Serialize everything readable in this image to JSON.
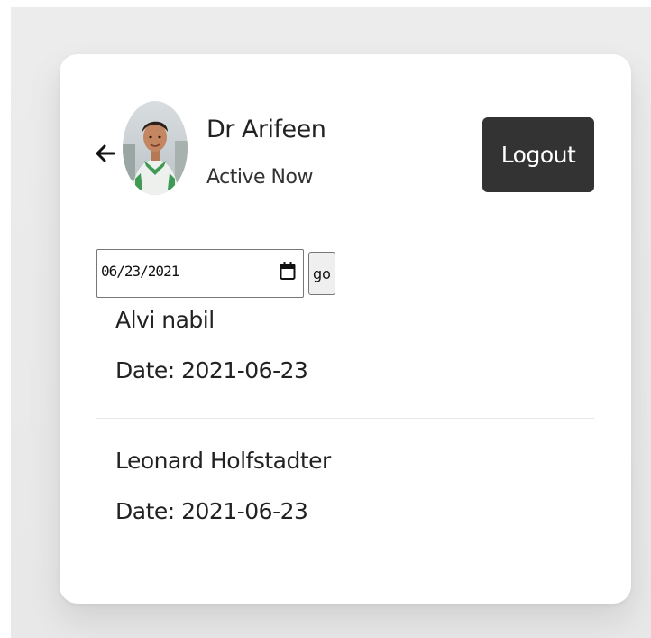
{
  "header": {
    "back_icon": "arrow-left-icon",
    "avatar_icon": "user-avatar",
    "name": "Dr Arifeen",
    "status": "Active Now",
    "logout_label": "Logout"
  },
  "filter": {
    "date_value": "06/23/2021",
    "calendar_icon": "calendar-icon",
    "go_label": "go"
  },
  "appointments": [
    {
      "name": "Alvi nabil",
      "date": "Date: 2021-06-23"
    },
    {
      "name": "Leonard Holfstadter",
      "date": "Date: 2021-06-23"
    }
  ],
  "colors": {
    "logout_bg": "#333333",
    "logout_text": "#ffffff",
    "background": "#ececec",
    "card": "#ffffff"
  }
}
